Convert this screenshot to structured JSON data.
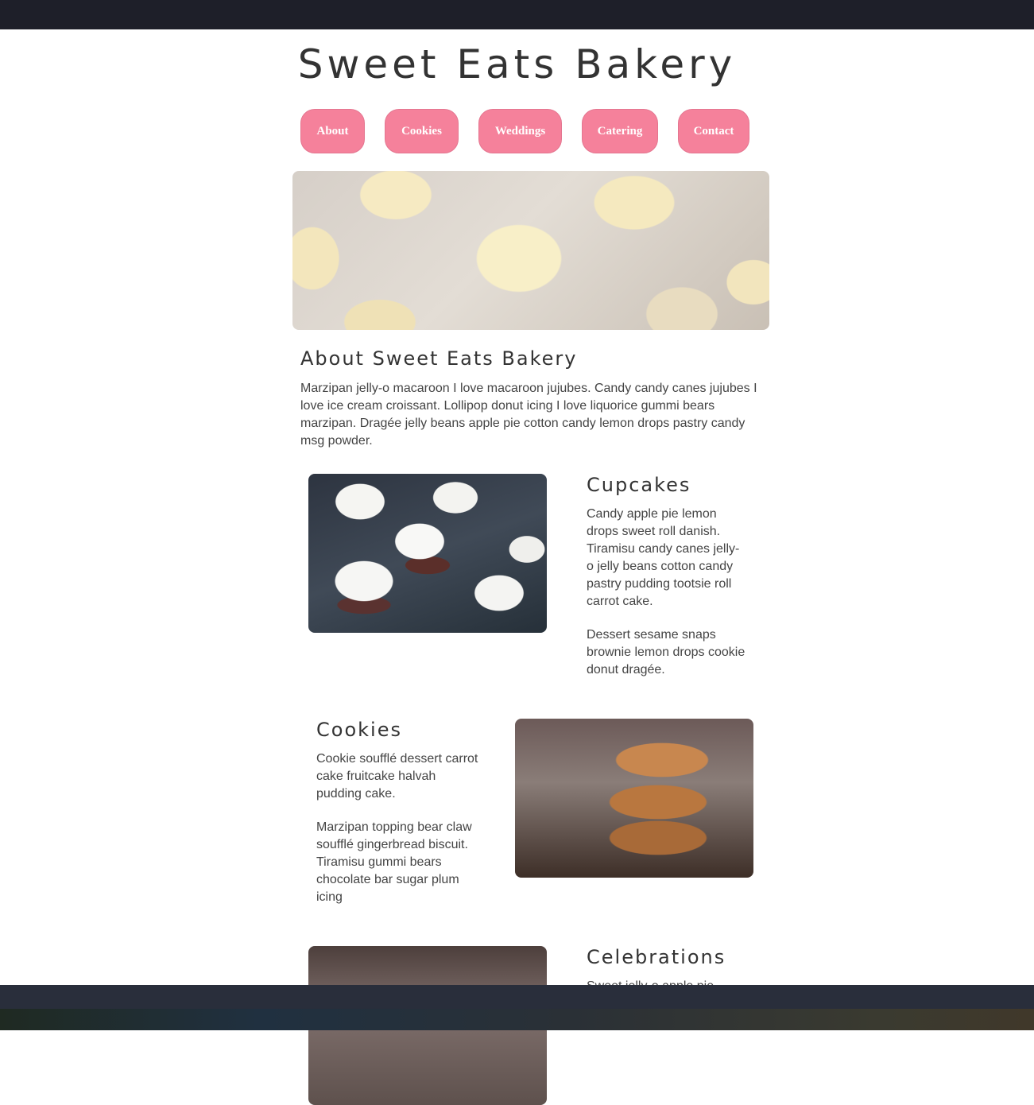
{
  "site": {
    "title": "Sweet Eats Bakery"
  },
  "nav": {
    "items": [
      "About",
      "Cookies",
      "Weddings",
      "Catering",
      "Contact"
    ]
  },
  "colors": {
    "nav_button": "#f5819b",
    "heading": "#333333",
    "body_text": "#444444",
    "topbar": "#1e1f29"
  },
  "about": {
    "heading": "About Sweet Eats Bakery",
    "text": "Marzipan jelly-o macaroon I love macaroon jujubes. Candy candy canes jujubes I love ice cream croissant. Lollipop donut icing I love liquorice gummi bears marzipan. Dragée jelly beans apple pie cotton candy lemon drops pastry candy msg powder."
  },
  "sections": {
    "cupcakes": {
      "heading": "Cupcakes",
      "p1": "Candy apple pie lemon drops sweet roll danish. Tiramisu candy canes jelly-o jelly beans cotton candy pastry pudding tootsie roll carrot cake.",
      "p2": "Dessert sesame snaps brownie lemon drops cookie donut dragée."
    },
    "cookies": {
      "heading": "Cookies",
      "p1": "Cookie soufflé dessert carrot cake fruitcake halvah pudding cake.",
      "p2": "Marzipan topping bear claw soufflé gingerbread biscuit. Tiramisu gummi bears chocolate bar sugar plum icing"
    },
    "celebrations": {
      "heading": "Celebrations",
      "p1": "Sweet jelly-o apple pie"
    }
  }
}
